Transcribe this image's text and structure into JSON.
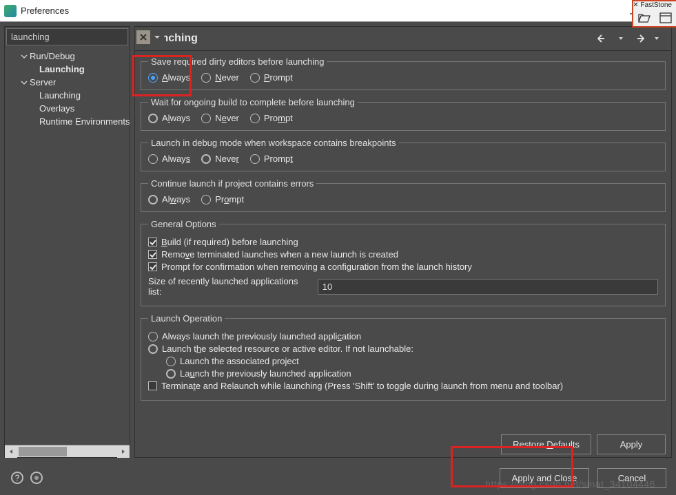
{
  "window": {
    "title": "Preferences"
  },
  "capture": {
    "label": "FastStone"
  },
  "sidebar": {
    "filter": "launching",
    "items": [
      {
        "label": "Run/Debug",
        "level": 1,
        "expand": true,
        "bold": false
      },
      {
        "label": "Launching",
        "level": 2,
        "expand": false,
        "bold": true
      },
      {
        "label": "Server",
        "level": 1,
        "expand": true,
        "bold": false
      },
      {
        "label": "Launching",
        "level": 2,
        "expand": false,
        "bold": false
      },
      {
        "label": "Overlays",
        "level": 2,
        "expand": false,
        "bold": false
      },
      {
        "label": "Runtime Environments",
        "level": 2,
        "expand": false,
        "bold": false
      }
    ]
  },
  "page": {
    "title": "Launching",
    "groups": {
      "save": {
        "legend": "Save required dirty editors before launching",
        "options": {
          "always": "Always",
          "never": "Never",
          "prompt": "Prompt"
        },
        "selected": "always"
      },
      "wait": {
        "legend": "Wait for ongoing build to complete before launching",
        "options": {
          "always": "Always",
          "never": "Never",
          "prompt": "Prompt"
        },
        "selected": "always"
      },
      "debug": {
        "legend": "Launch in debug mode when workspace contains breakpoints",
        "options": {
          "always": "Always",
          "never": "Never",
          "prompt": "Prompt"
        },
        "selected": "never"
      },
      "errors": {
        "legend": "Continue launch if project contains errors",
        "options": {
          "always": "Always",
          "prompt": "Prompt"
        },
        "selected": "always"
      },
      "general": {
        "legend": "General Options",
        "build": "Build (if required) before launching",
        "remove": "Remove terminated launches when a new launch is created",
        "confirm": "Prompt for confirmation when removing a configuration from the launch history",
        "sizeLabel": "Size of recently launched applications list:",
        "sizeValue": "10"
      },
      "op": {
        "legend": "Launch Operation",
        "prev": "Always launch the previously launched application",
        "sel": "Launch the selected resource or active editor. If not launchable:",
        "selSelected": true,
        "assoc": "Launch the associated project",
        "prevApp": "Launch the previously launched application",
        "subSelected": "prevApp",
        "term": "Terminate and Relaunch while launching (Press 'Shift' to toggle during launch from menu and toolbar)"
      }
    },
    "buttons": {
      "restore": "Restore Defaults",
      "apply": "Apply",
      "applyClose": "Apply and Close",
      "cancel": "Cancel"
    }
  },
  "watermark": "https://blog.csdn.net/sinat_34104446"
}
